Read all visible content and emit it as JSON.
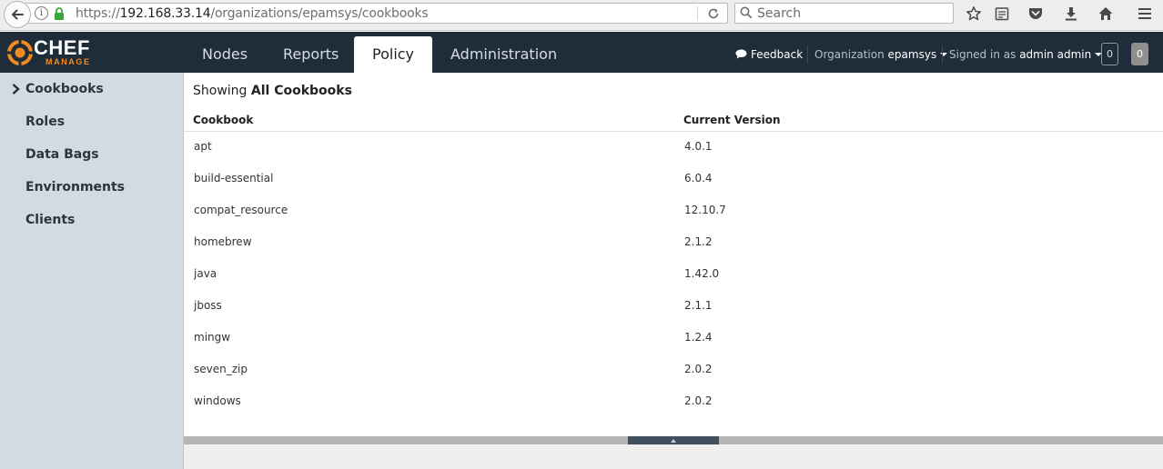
{
  "browser": {
    "url_prefix": "https://",
    "url_host": "192.168.33.14",
    "url_path": "/organizations/epamsys/cookbooks",
    "search_placeholder": "Search",
    "info_glyph": "i"
  },
  "logo": {
    "word": "CHEF",
    "sub": "MANAGE"
  },
  "nav": {
    "tabs": [
      {
        "label": "Nodes"
      },
      {
        "label": "Reports"
      },
      {
        "label": "Policy"
      },
      {
        "label": "Administration"
      }
    ],
    "active_tab": "Policy"
  },
  "header": {
    "feedback_label": "Feedback",
    "org_prefix": "Organization",
    "org_name": "epamsys",
    "signed_prefix": "Signed in as",
    "user_name": "admin admin",
    "badge_1": "0",
    "badge_2": "0"
  },
  "sidebar": {
    "items": [
      {
        "label": "Cookbooks",
        "active": true
      },
      {
        "label": "Roles"
      },
      {
        "label": "Data Bags"
      },
      {
        "label": "Environments"
      },
      {
        "label": "Clients"
      }
    ]
  },
  "main": {
    "showing_prefix": "Showing",
    "showing_value": "All Cookbooks",
    "columns": [
      "Cookbook",
      "Current Version"
    ],
    "rows": [
      {
        "name": "apt",
        "version": "4.0.1"
      },
      {
        "name": "build-essential",
        "version": "6.0.4"
      },
      {
        "name": "compat_resource",
        "version": "12.10.7"
      },
      {
        "name": "homebrew",
        "version": "2.1.2"
      },
      {
        "name": "java",
        "version": "1.42.0"
      },
      {
        "name": "jboss",
        "version": "2.1.1"
      },
      {
        "name": "mingw",
        "version": "1.2.4"
      },
      {
        "name": "seven_zip",
        "version": "2.0.2"
      },
      {
        "name": "windows",
        "version": "2.0.2"
      }
    ]
  },
  "colors": {
    "header_bg": "#1f2d3a",
    "sidebar_bg": "#d4dae1",
    "brand_orange": "#f18b21",
    "lock_green": "#3aa53a"
  }
}
